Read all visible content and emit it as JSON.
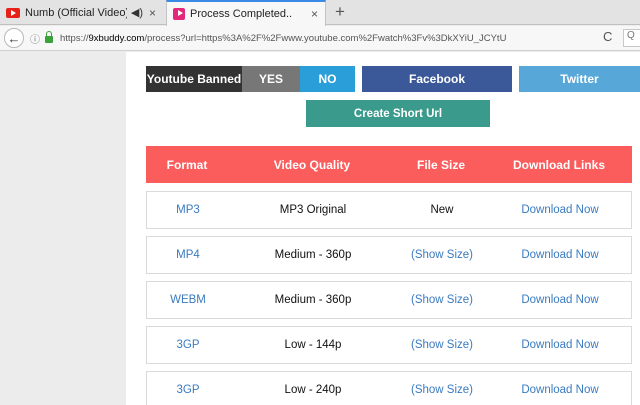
{
  "browser": {
    "tabs": [
      {
        "title": "Numb (Official Video) ...",
        "audio_icon": "speaker-icon",
        "close": "×"
      },
      {
        "title": "Process Completed..",
        "close": "×"
      }
    ],
    "new_tab": "+",
    "back": "←",
    "site_info": "ⓘ",
    "url_prefix": "https://",
    "url_host": "9xbuddy.com",
    "url_rest": "/process?url=https%3A%2F%2Fwww.youtube.com%2Fwatch%3Fv%3DkXYiU_JCYtU",
    "reload": "C",
    "search_label": "Q"
  },
  "colors": {
    "youtube_red": "#e62117",
    "accent_blue": "#2a9ed8",
    "facebook": "#3b5998",
    "twitter": "#57a8d8",
    "short_url": "#3a9a8c",
    "table_header": "#fb5c5c",
    "link": "#3a7bc0"
  },
  "actions": {
    "youtube_banned": "Youtube Banned",
    "yes": "YES",
    "no": "NO",
    "facebook": "Facebook",
    "twitter": "Twitter",
    "short_url": "Create Short Url"
  },
  "table": {
    "headers": [
      "Format",
      "Video Quality",
      "File Size",
      "Download Links"
    ],
    "rows": [
      {
        "format": "MP3",
        "quality": "MP3 Original",
        "size": "New",
        "link": "Download Now"
      },
      {
        "format": "MP4",
        "quality": "Medium - 360p",
        "size": "(Show Size)",
        "link": "Download Now"
      },
      {
        "format": "WEBM",
        "quality": "Medium - 360p",
        "size": "(Show Size)",
        "link": "Download Now"
      },
      {
        "format": "3GP",
        "quality": "Low - 144p",
        "size": "(Show Size)",
        "link": "Download Now"
      },
      {
        "format": "3GP",
        "quality": "Low - 240p",
        "size": "(Show Size)",
        "link": "Download Now"
      }
    ]
  }
}
